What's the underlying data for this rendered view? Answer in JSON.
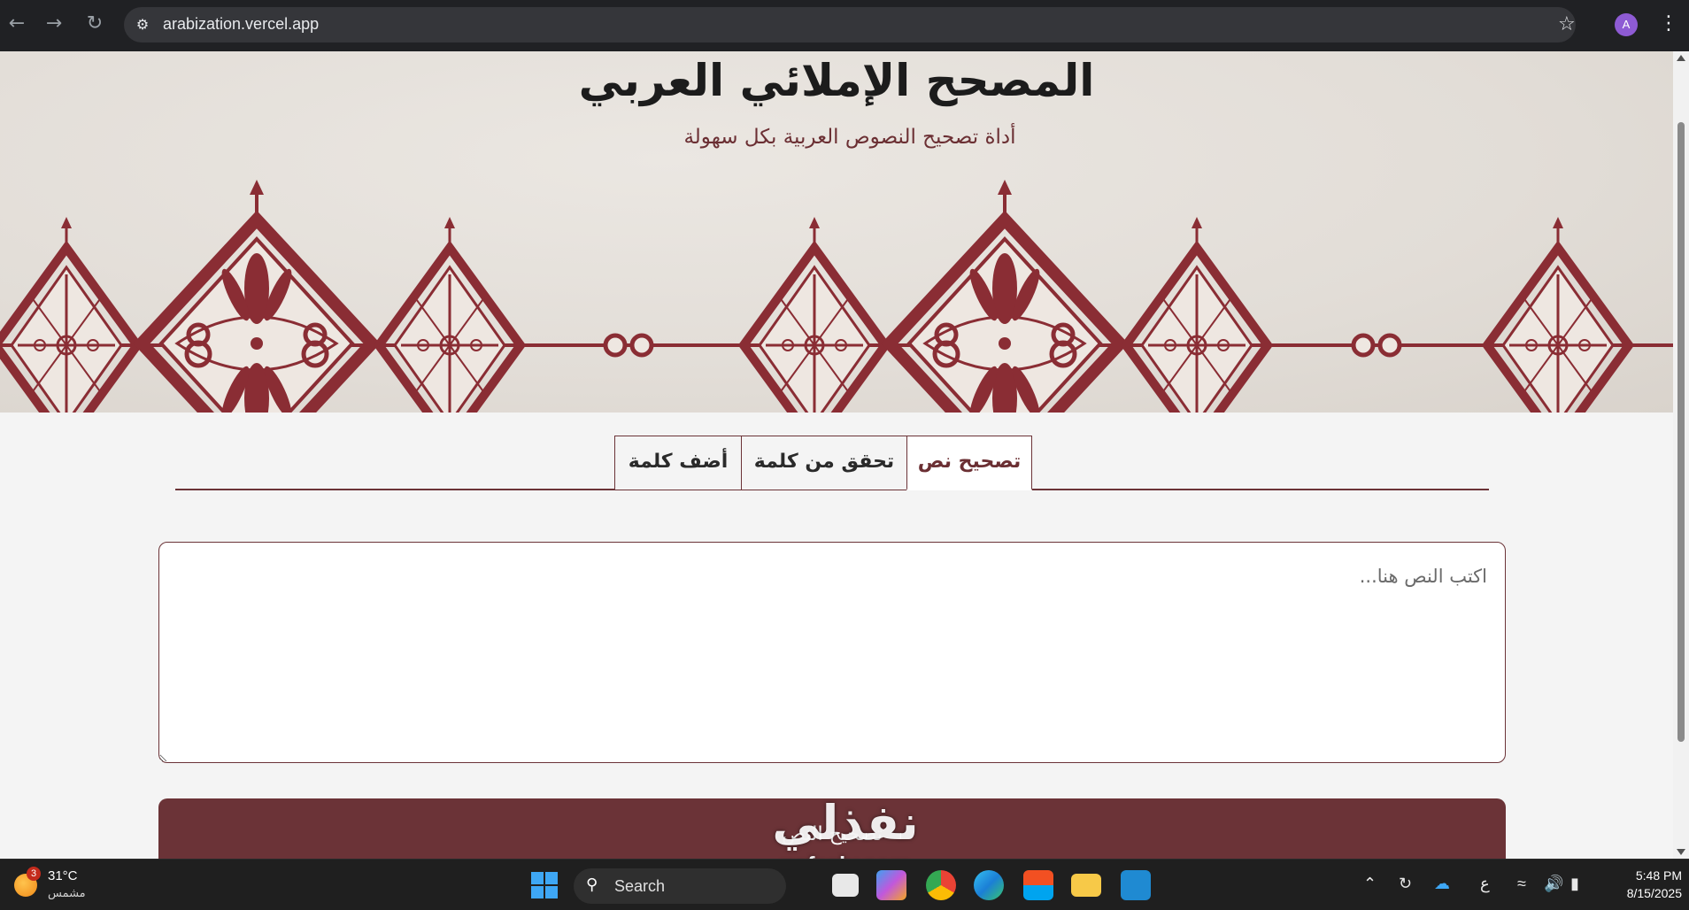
{
  "browser": {
    "url": "arabization.vercel.app",
    "profile_initial": "A"
  },
  "hero": {
    "title": "المصحح الإملائي العربي",
    "subtitle": "أداة تصحيح النصوص العربية بكل سهولة"
  },
  "tabs": [
    {
      "label": "تصحيح نص",
      "active": true
    },
    {
      "label": "تحقق من كلمة",
      "active": false
    },
    {
      "label": "أضف كلمة",
      "active": false
    }
  ],
  "editor": {
    "placeholder": "اكتب النص هنا...",
    "value": ""
  },
  "submit": {
    "label": "تصحيح النص"
  },
  "watermark": {
    "arabic": "نفذلي",
    "latin": "nafezly.com"
  },
  "taskbar": {
    "weather_temp": "31°C",
    "weather_condition": "مشمس",
    "weather_badge": "3",
    "search_label": "Search",
    "language": "ع",
    "time": "5:48 PM",
    "date": "8/15/2025"
  },
  "colors": {
    "accent": "#6b3337",
    "subtitle": "#6b2f33"
  }
}
